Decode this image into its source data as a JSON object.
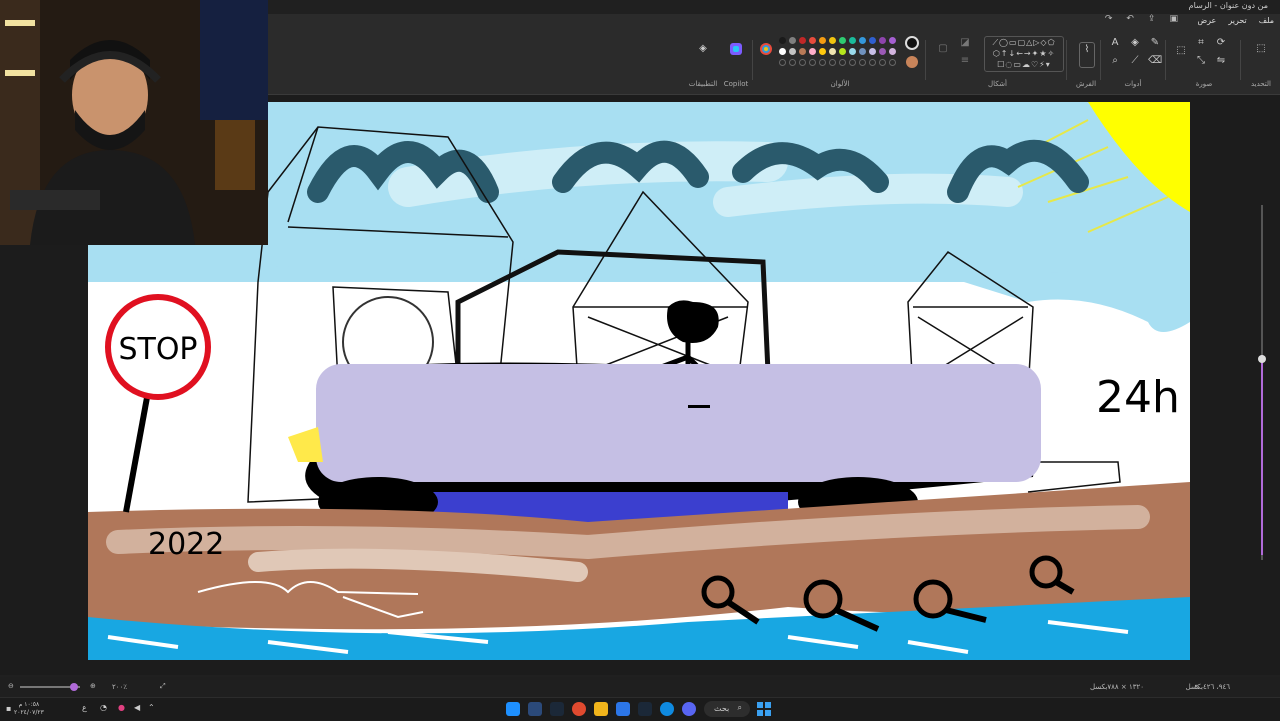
{
  "window": {
    "title": "من دون عنوان - الرسام"
  },
  "menu": {
    "file": "ملف",
    "edit": "تحرير",
    "view": "عرض"
  },
  "ribbon": {
    "groups": {
      "select": "التحديد",
      "image": "صورة",
      "tools": "أدوات",
      "brushes": "الفرش",
      "shapes": "أشكال",
      "colors": "الألوان",
      "copilot": "Copilot",
      "apps": "التطبيقات"
    }
  },
  "palette": {
    "row1": [
      "#1a1a1a",
      "#7f7f7f",
      "#c02727",
      "#e84c3d",
      "#f39c12",
      "#f1c40f",
      "#2ecc71",
      "#1abc9c",
      "#3498db",
      "#2f5fd0",
      "#8e44ad",
      "#a55fd1"
    ],
    "row2": [
      "#ffffff",
      "#c3c3c3",
      "#b97a57",
      "#ffaec9",
      "#ffc90e",
      "#efe4b0",
      "#b5e61d",
      "#99d9ea",
      "#7092be",
      "#c8bfe7",
      "#9b59b6",
      "#d2b4de"
    ],
    "primary": "#111111",
    "secondary": "#c8845a"
  },
  "canvas": {
    "texts": {
      "stop": "STOP",
      "year": "2022",
      "hours": "24h"
    }
  },
  "statusbar": {
    "selection_size": "١٣٢٠ × ٧٨٨بكسل",
    "cursor_pos": "٩٤٦، ٤٢٦بكسل",
    "zoom": "٢٠٠٪"
  },
  "taskbar": {
    "search": "بحث",
    "time": "١٠:٥٨ م",
    "date": "٢٠٢٤/٠٧/٢٣",
    "lang": "ع"
  }
}
